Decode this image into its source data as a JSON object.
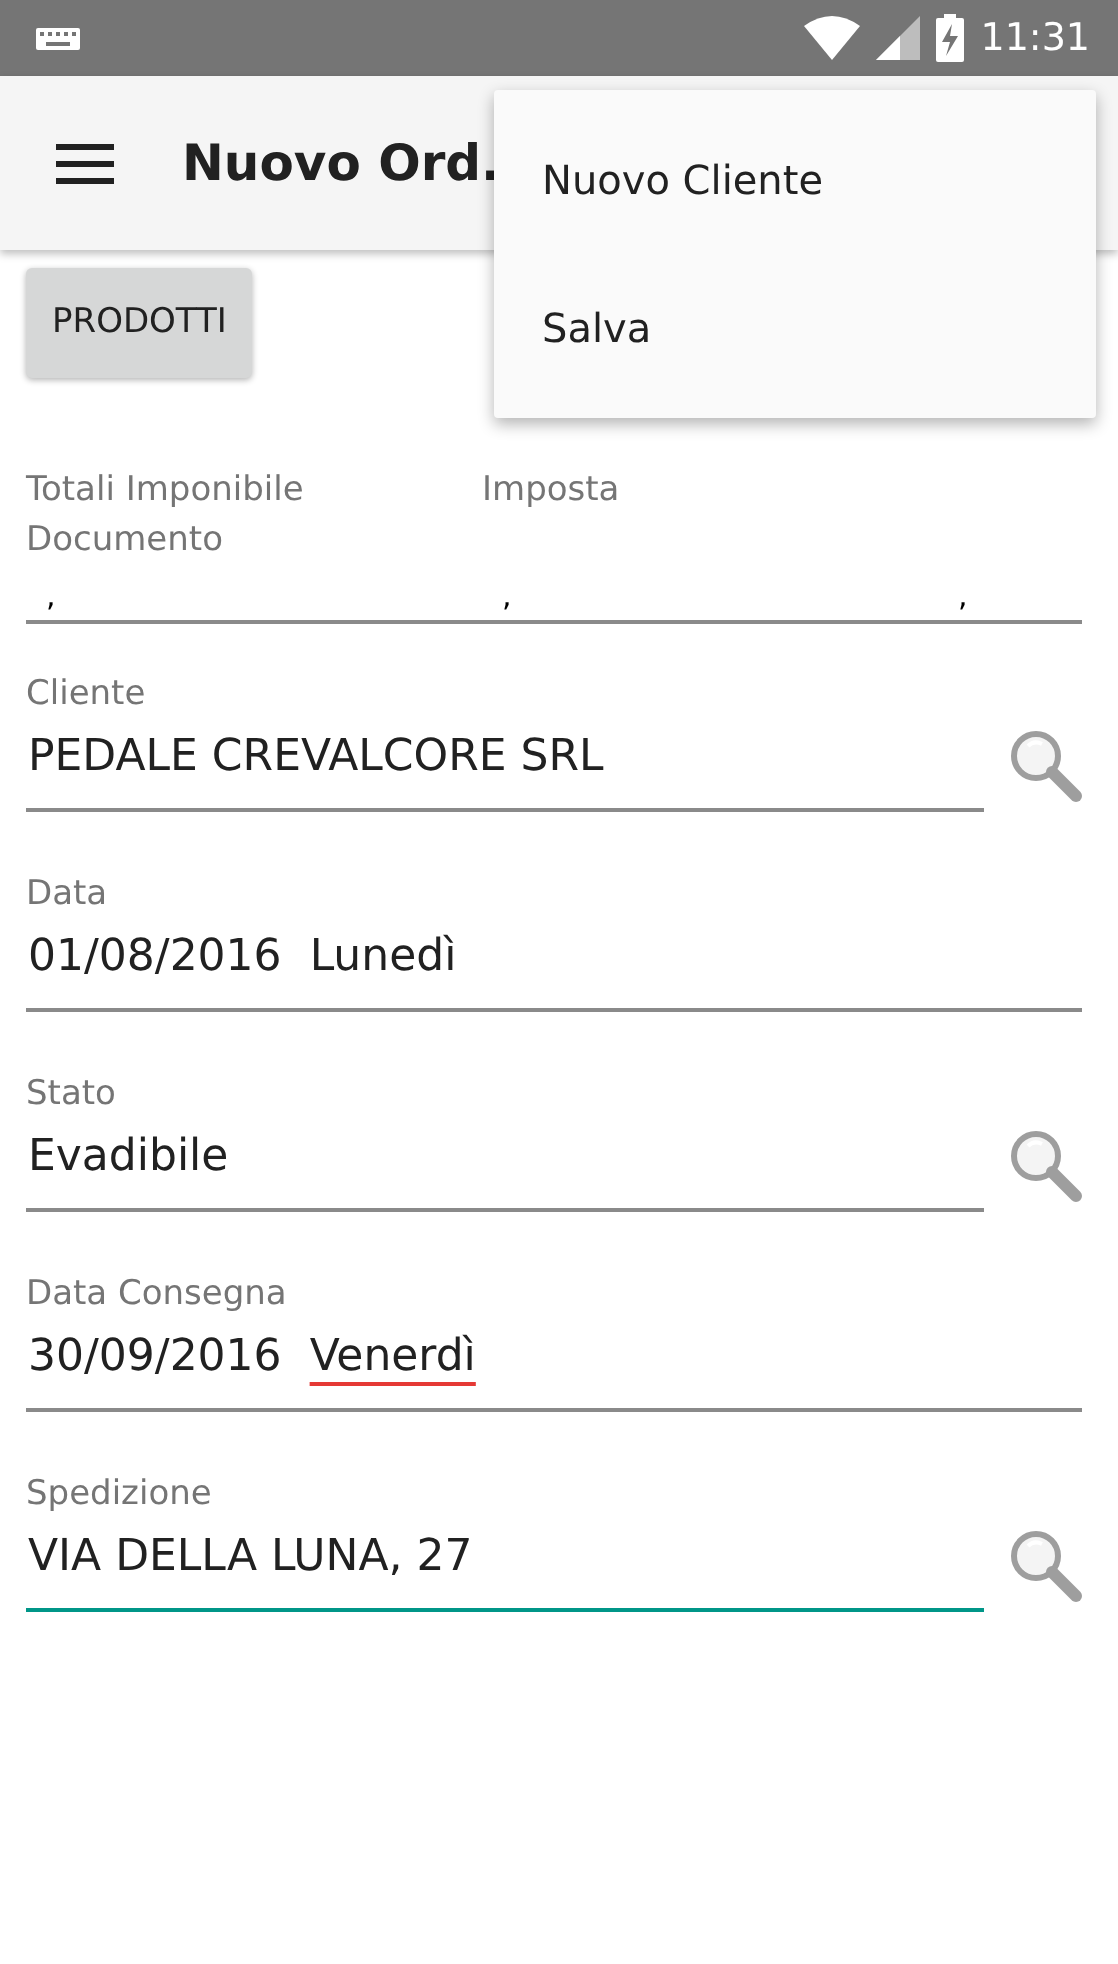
{
  "status_bar": {
    "time": "11:31"
  },
  "app_bar": {
    "title": "Nuovo Ord."
  },
  "overflow_menu": {
    "items": [
      {
        "label": "Nuovo Cliente"
      },
      {
        "label": "Salva"
      }
    ]
  },
  "products_button": {
    "label": "PRODOTTI"
  },
  "totals": [
    {
      "label": "Totali Imponibile Documento",
      "value": ","
    },
    {
      "label": "Imposta",
      "value": ","
    },
    {
      "value": ","
    }
  ],
  "fields": [
    {
      "label": "Cliente",
      "value": [
        {
          "text": "PEDALE CREVALCORE SRL",
          "flagged": false
        }
      ],
      "lookup": true,
      "focused": false
    },
    {
      "label": "Data",
      "value": [
        {
          "text": "01/08/2016",
          "flagged": false
        },
        {
          "text": "Lunedì",
          "flagged": false
        }
      ],
      "lookup": false,
      "focused": false
    },
    {
      "label": "Stato",
      "value": [
        {
          "text": "Evadibile",
          "flagged": false
        }
      ],
      "lookup": true,
      "focused": false
    },
    {
      "label": "Data Consegna",
      "value": [
        {
          "text": "30/09/2016",
          "flagged": false
        },
        {
          "text": "Venerdì",
          "flagged": true
        }
      ],
      "lookup": false,
      "focused": false
    },
    {
      "label": "Spedizione",
      "value": [
        {
          "text": "VIA DELLA LUNA, 27",
          "flagged": false
        }
      ],
      "lookup": true,
      "focused": true
    }
  ]
}
